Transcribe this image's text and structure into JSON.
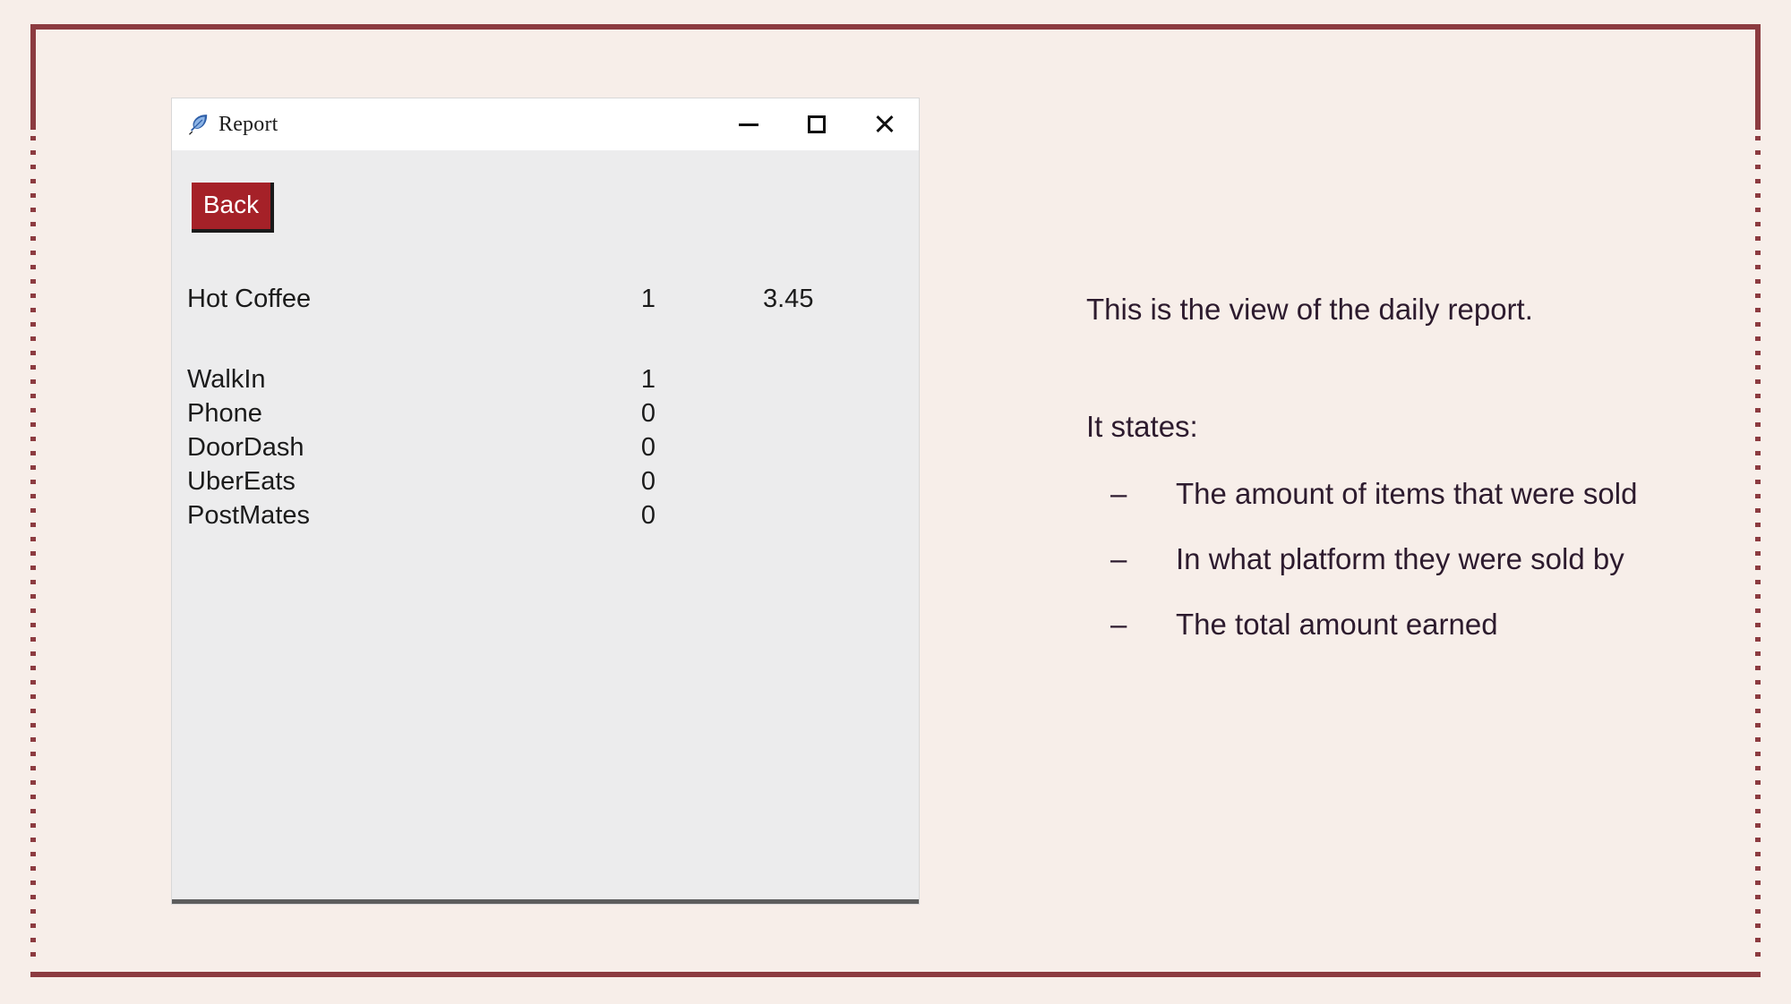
{
  "window": {
    "title": "Report",
    "icon": "feather-icon",
    "controls": {
      "minimize": "—",
      "maximize": "□",
      "close": "✕"
    },
    "back_button": "Back",
    "accent_color": "#a52128",
    "client_background": "#ececed"
  },
  "report": {
    "items": [
      {
        "name": "Hot Coffee",
        "qty": "1",
        "price": "3.45"
      }
    ],
    "platforms": [
      {
        "name": "WalkIn",
        "count": "1"
      },
      {
        "name": "Phone",
        "count": "0"
      },
      {
        "name": "DoorDash",
        "count": "0"
      },
      {
        "name": "UberEats",
        "count": "0"
      },
      {
        "name": "PostMates",
        "count": "0"
      }
    ]
  },
  "annotation": {
    "intro": "This is the view of the daily report.",
    "states_label": "It states:",
    "bullet_glyph": "–",
    "bullets": [
      "The amount of items that were sold",
      "In what platform they were sold by",
      "The total amount earned"
    ]
  },
  "theme": {
    "page_background": "#f7eee9",
    "frame_color": "#8c3b40",
    "text_color": "#2d1b2e"
  }
}
